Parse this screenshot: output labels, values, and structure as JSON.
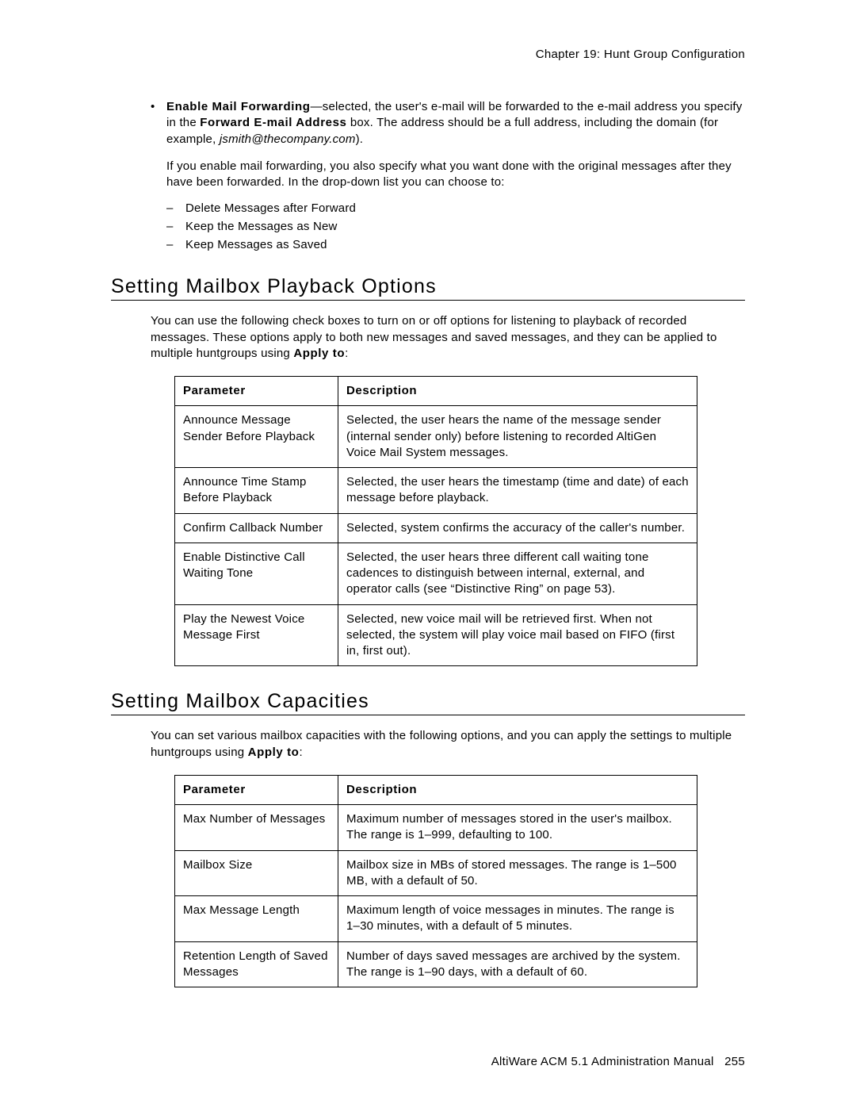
{
  "chapter_header": "Chapter 19:  Hunt Group Configuration",
  "bullet": {
    "label_bold": "Enable Mail Forwarding",
    "text_part1": "—selected, the user's e-mail will be forwarded to the e-mail address you specify in the ",
    "label_bold2": "Forward E-mail Address",
    "text_part2": " box. The address should be a full address, including the domain (for example, ",
    "example_italic": "jsmith@thecompany.com",
    "text_part3": ")."
  },
  "sub_para": "If you enable mail forwarding, you also specify what you want done with the original messages after they have been forwarded. In the drop-down list you can choose to:",
  "dash_items": [
    "Delete Messages after Forward",
    "Keep the Messages as New",
    "Keep Messages as Saved"
  ],
  "section1": {
    "title": "Setting Mailbox Playback Options",
    "para_a": "You can use the following check boxes to turn on or off options for listening to playback of recorded messages. These options apply to both new messages and saved messages, and they can be applied to multiple huntgroups using ",
    "para_bold": "Apply to",
    "para_b": ":",
    "th1": "Parameter",
    "th2": "Description",
    "rows": [
      {
        "p": "Announce Message Sender Before Playback",
        "d": "Selected, the user hears the name of the message sender (internal sender only) before listening to recorded AltiGen Voice Mail System messages."
      },
      {
        "p": "Announce Time Stamp Before Playback",
        "d": "Selected, the user hears the timestamp (time and date) of each message before playback."
      },
      {
        "p": "Confirm Callback Number",
        "d": "Selected, system confirms the accuracy of the caller's number."
      },
      {
        "p": "Enable Distinctive Call Waiting Tone",
        "d": "Selected, the user hears three different call waiting tone cadences to distinguish between internal, external, and operator calls (see “Distinctive Ring” on page 53)."
      },
      {
        "p": "Play the Newest Voice Message First",
        "d": "Selected, new voice mail will be retrieved first. When not selected, the system will play voice mail based on FIFO (first in, first out)."
      }
    ]
  },
  "section2": {
    "title": "Setting Mailbox Capacities",
    "para_a": "You can set various mailbox capacities with the following options, and you can apply the settings to multiple huntgroups using ",
    "para_bold": "Apply to",
    "para_b": ":",
    "th1": "Parameter",
    "th2": "Description",
    "rows": [
      {
        "p": "Max Number of Messages",
        "d": "Maximum number of messages stored in the user's mailbox. The range is 1–999, defaulting to 100."
      },
      {
        "p": "Mailbox Size",
        "d": "Mailbox size in MBs of stored messages. The range is 1–500 MB, with a default of 50."
      },
      {
        "p": "Max Message Length",
        "d": "Maximum length of voice messages in minutes. The range is 1–30 minutes, with a default of 5 minutes."
      },
      {
        "p": "Retention Length of Saved Messages",
        "d": "Number of days saved messages are archived by the system. The range is 1–90 days, with a default of 60."
      }
    ]
  },
  "footer_a": "AltiWare ACM 5.1 Administration Manual",
  "footer_b": "255"
}
